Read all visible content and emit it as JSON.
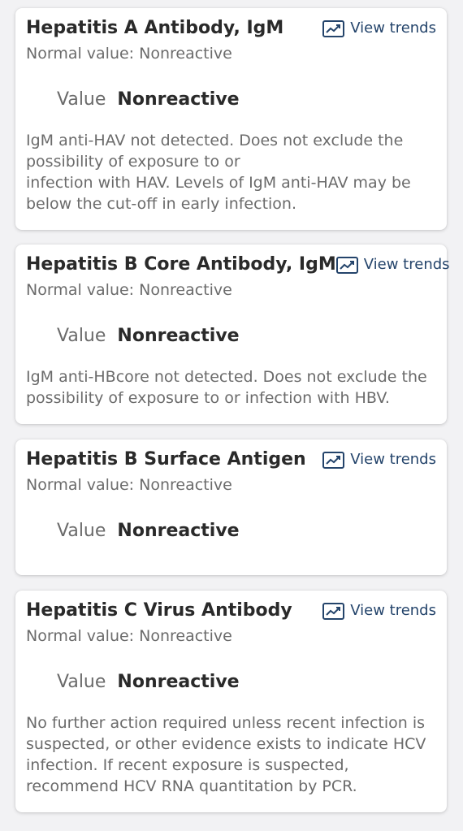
{
  "common": {
    "trends_label": "View trends",
    "value_label": "Value"
  },
  "results": [
    {
      "title": "Hepatitis A Antibody, IgM",
      "normal": "Normal value: Nonreactive",
      "value": "Nonreactive",
      "comment": "IgM anti-HAV not detected. Does not exclude the\npossibility of exposure to or\ninfection with HAV. Levels of IgM anti-HAV may be\nbelow the cut-off in early infection."
    },
    {
      "title": "Hepatitis B Core Antibody, IgM",
      "normal": "Normal value: Nonreactive",
      "value": "Nonreactive",
      "comment": "IgM anti-HBcore not detected. Does not exclude the\npossibility of exposure to or infection with HBV."
    },
    {
      "title": "Hepatitis B Surface Antigen",
      "normal": "Normal value: Nonreactive",
      "value": "Nonreactive"
    },
    {
      "title": "Hepatitis C Virus Antibody",
      "normal": "Normal value: Nonreactive",
      "value": "Nonreactive",
      "comment": "No further action required unless recent infection is\nsuspected, or other evidence exists to indicate HCV\ninfection. If recent exposure is suspected,\nrecommend HCV RNA quantitation by PCR."
    }
  ]
}
